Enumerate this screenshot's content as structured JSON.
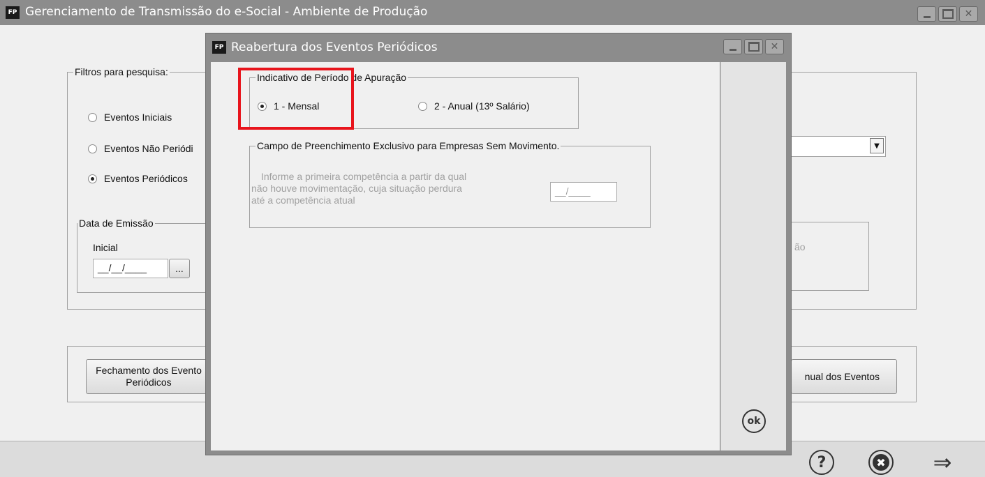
{
  "main_window": {
    "icon_text": "FP",
    "title": "Gerenciamento de Transmissão do e-Social - Ambiente de Produção",
    "filters": {
      "legend": "Filtros para pesquisa:",
      "options": [
        {
          "label": "Eventos Iniciais",
          "checked": false
        },
        {
          "label": "Eventos Não Periódi",
          "checked": false
        },
        {
          "label": "Eventos Periódicos",
          "checked": true
        }
      ]
    },
    "emission_date": {
      "legend": "Data de Emissão",
      "initial_label": "Inicial",
      "initial_value": "__/__/____",
      "picker_label": "..."
    },
    "partial_status_text": "ão",
    "close_events_button": "Fechamento dos Evento\nPeriódicos",
    "manual_events_button": "nual dos Eventos"
  },
  "dialog": {
    "icon_text": "FP",
    "title": "Reabertura dos Eventos Periódicos",
    "period_group": {
      "legend": "Indicativo de Período de Apuração",
      "options": [
        {
          "label": "1 - Mensal",
          "checked": true
        },
        {
          "label": "2 - Anual (13º Salário)",
          "checked": false
        }
      ]
    },
    "no_movement_group": {
      "legend": "Campo de Preenchimento Exclusivo para Empresas Sem Movimento.",
      "hint_line1": "Informe a primeira competência a partir da  qual",
      "hint_line2": "não houve movimentação, cuja situação perdura",
      "hint_line3": "até a competência atual",
      "competence_value": "__/____"
    },
    "ok_label": "ok"
  },
  "bottom_bar": {
    "help_glyph": "?",
    "cancel_glyph": "✖",
    "next_glyph": "⇒"
  },
  "colors": {
    "titlebar": "#8c8c8c",
    "highlight": "#e8141c"
  }
}
